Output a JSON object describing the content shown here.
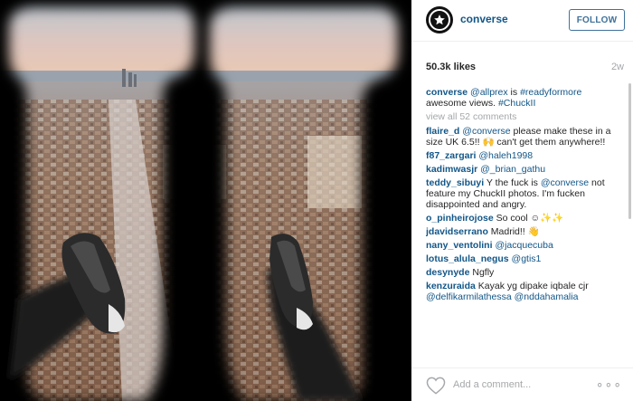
{
  "post": {
    "username": "converse",
    "follow_label": "FOLLOW",
    "likes": "50.3k likes",
    "age": "2w"
  },
  "caption": {
    "user": "converse",
    "mention": "@allprex",
    "text_1": " is ",
    "tag_1": "#readyformore",
    "text_2": " awesome views. ",
    "tag_2": "#ChuckII"
  },
  "view_all": "view all 52 comments",
  "comments": [
    {
      "user": "flaire_d",
      "mention": "@converse",
      "text": " please make these in a size UK 6.5!! 🙌 can't get them anywhere!!"
    },
    {
      "user": "f87_zargari",
      "mention": "@haleh1998",
      "text": ""
    },
    {
      "user": "kadimwasjr",
      "mention": "@_brian_gathu",
      "text": ""
    },
    {
      "user": "teddy_sibuyi",
      "pre": " Y the fuck is ",
      "mention": "@converse",
      "text": " not feature my ChuckII photos. I'm fucken disappointed and angry."
    },
    {
      "user": "o_pinheirojose",
      "mention": "",
      "text": " So cool ☺✨✨"
    },
    {
      "user": "jdavidserrano",
      "mention": "",
      "text": " Madrid!! 👋"
    },
    {
      "user": "nany_ventolini",
      "mention": "@jacquecuba",
      "text": ""
    },
    {
      "user": "lotus_alula_negus",
      "mention": "@gtis1",
      "text": ""
    },
    {
      "user": "desynyde",
      "mention": "",
      "text": " Ngfly"
    },
    {
      "user": "kenzuraida",
      "mention": "",
      "text": " Kayak yg dipake iqbale cjr",
      "extra_1": "@delfikarmilathessa",
      "extra_2": "@nddahamalia"
    }
  ],
  "footer": {
    "placeholder": "Add a comment...",
    "more": "∘∘∘"
  },
  "icons": {
    "avatar": "converse-star-logo",
    "heart": "heart-outline-icon",
    "more": "more-options-icon"
  },
  "colors": {
    "link": "#125688",
    "follow": "#3f729b",
    "muted": "#a5a7aa"
  }
}
